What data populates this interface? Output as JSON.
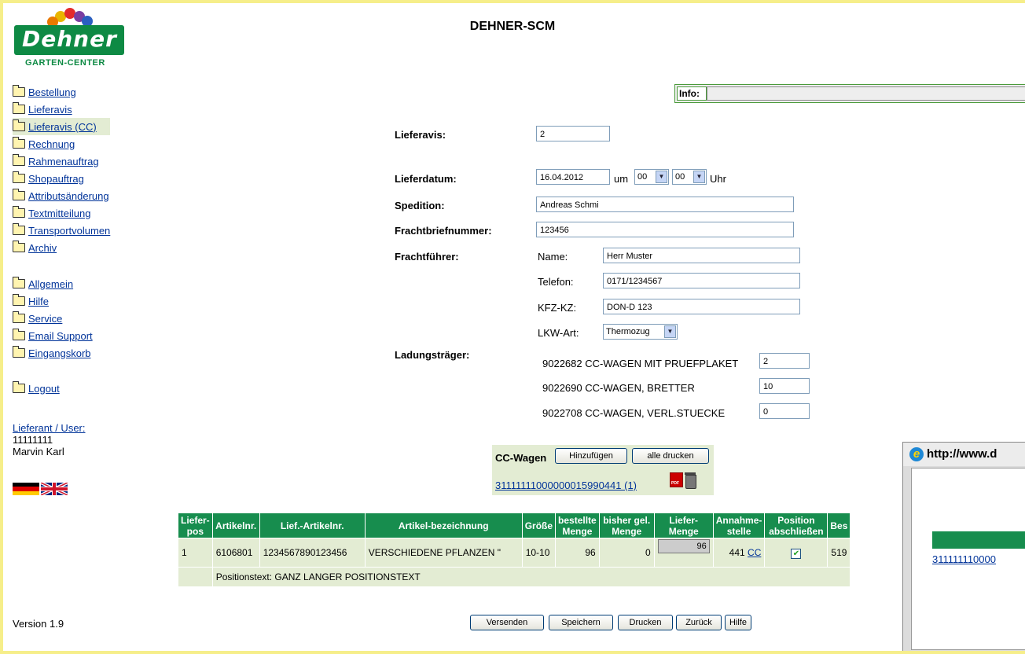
{
  "app": {
    "title": "DEHNER-SCM",
    "logo_text": "Dehner",
    "logo_subtitle": "GARTEN-CENTER",
    "version": "Version 1.9"
  },
  "nav": {
    "group1": [
      {
        "label": "Bestellung"
      },
      {
        "label": "Lieferavis"
      },
      {
        "label": "Lieferavis (CC)",
        "active": true
      },
      {
        "label": "Rechnung"
      },
      {
        "label": "Rahmenauftrag"
      },
      {
        "label": "Shopauftrag"
      },
      {
        "label": "Attributsänderung"
      },
      {
        "label": "Textmitteilung"
      },
      {
        "label": "Transportvolumen"
      },
      {
        "label": "Archiv"
      }
    ],
    "group2": [
      {
        "label": "Allgemein"
      },
      {
        "label": "Hilfe"
      },
      {
        "label": "Service"
      },
      {
        "label": "Email Support"
      },
      {
        "label": "Eingangskorb"
      }
    ],
    "logout": "Logout"
  },
  "user": {
    "label": "Lieferant / User:",
    "id": "11111111",
    "name": "Marvin Karl"
  },
  "info": {
    "label": "Info:",
    "value": ""
  },
  "form": {
    "lieferavis_label": "Lieferavis:",
    "lieferavis_value": "2",
    "lieferdatum_label": "Lieferdatum:",
    "lieferdatum_value": "16.04.2012",
    "um": "um",
    "hour": "00",
    "minute": "00",
    "uhr": "Uhr",
    "spedition_label": "Spedition:",
    "spedition_value": "Andreas Schmi",
    "frachtbrief_label": "Frachtbriefnummer:",
    "frachtbrief_value": "123456",
    "frachtfuehrer_label": "Frachtführer:",
    "name_label": "Name:",
    "name_value": "Herr Muster",
    "telefon_label": "Telefon:",
    "telefon_value": "0171/1234567",
    "kfz_label": "KFZ-KZ:",
    "kfz_value": "DON-D 123",
    "lkw_label": "LKW-Art:",
    "lkw_value": "Thermozug",
    "ladung_label": "Ladungsträger:",
    "ladung": [
      {
        "label": "9022682 CC-WAGEN MIT PRUEFPLAKET",
        "value": "2"
      },
      {
        "label": "9022690 CC-WAGEN, BRETTER",
        "value": "10"
      },
      {
        "label": "9022708 CC-WAGEN, VERL.STUECKE",
        "value": "0"
      }
    ]
  },
  "ccwagen": {
    "label": "CC-Wagen",
    "add_button": "Hinzufügen",
    "print_all_button": "alle drucken",
    "link": "31111111000000015990441 (1)"
  },
  "table": {
    "headers": [
      "Liefer-pos",
      "Artikelnr.",
      "Lief.-Artikelnr.",
      "Artikel-bezeichnung",
      "Größe",
      "bestellte Menge",
      "bisher gel. Menge",
      "Liefer-Menge",
      "Annahme-stelle",
      "Position abschließen",
      "Bes"
    ],
    "row": {
      "pos": "1",
      "artikelnr": "6106801",
      "lief_artikelnr": "1234567890123456",
      "bezeichnung": "VERSCHIEDENE PFLANZEN \"",
      "groesse": "10-10",
      "bestellt": "96",
      "bisher": "0",
      "liefer": "96",
      "annahme_num": "441",
      "annahme_link": "CC",
      "bes": "519"
    },
    "positionstext": "Positionstext: GANZ LANGER POSITIONSTEXT"
  },
  "buttons": {
    "versenden": "Versenden",
    "speichern": "Speichern",
    "drucken": "Drucken",
    "zurueck": "Zurück",
    "hilfe": "Hilfe"
  },
  "popup": {
    "title": "http://www.d",
    "link": "311111110000"
  }
}
